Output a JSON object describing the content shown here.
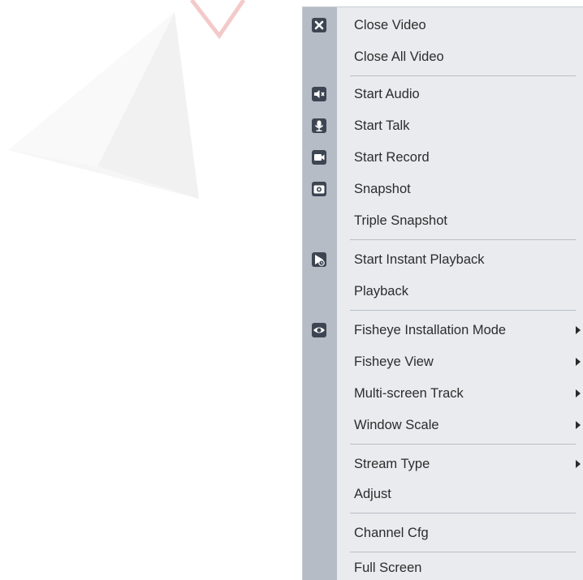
{
  "context_menu": {
    "items": {
      "close_video": {
        "label": "Close Video",
        "icon": "close-icon"
      },
      "close_all_video": {
        "label": "Close All Video"
      },
      "start_audio": {
        "label": "Start Audio",
        "icon": "speaker-icon"
      },
      "start_talk": {
        "label": "Start Talk",
        "icon": "microphone-icon"
      },
      "start_record": {
        "label": "Start Record",
        "icon": "video-camera-icon"
      },
      "snapshot": {
        "label": "Snapshot",
        "icon": "camera-icon"
      },
      "triple_snapshot": {
        "label": "Triple Snapshot"
      },
      "start_instant_playback": {
        "label": "Start Instant Playback",
        "icon": "playback-icon"
      },
      "playback": {
        "label": "Playback"
      },
      "fisheye_installation_mode": {
        "label": "Fisheye Installation Mode",
        "icon": "eye-icon",
        "has_submenu": true
      },
      "fisheye_view": {
        "label": "Fisheye View",
        "has_submenu": true
      },
      "multi_screen_track": {
        "label": "Multi-screen Track",
        "has_submenu": true
      },
      "window_scale": {
        "label": "Window Scale",
        "has_submenu": true
      },
      "stream_type": {
        "label": "Stream Type",
        "has_submenu": true
      },
      "adjust": {
        "label": "Adjust"
      },
      "channel_cfg": {
        "label": "Channel Cfg"
      },
      "full_screen": {
        "label": "Full Screen"
      }
    }
  },
  "colors": {
    "menu_background": "#e9ebee",
    "icon_gutter": "#b5bcc6",
    "icon_fill": "#3d4552",
    "text": "#2c2c2c",
    "separator": "#b9bec6"
  }
}
